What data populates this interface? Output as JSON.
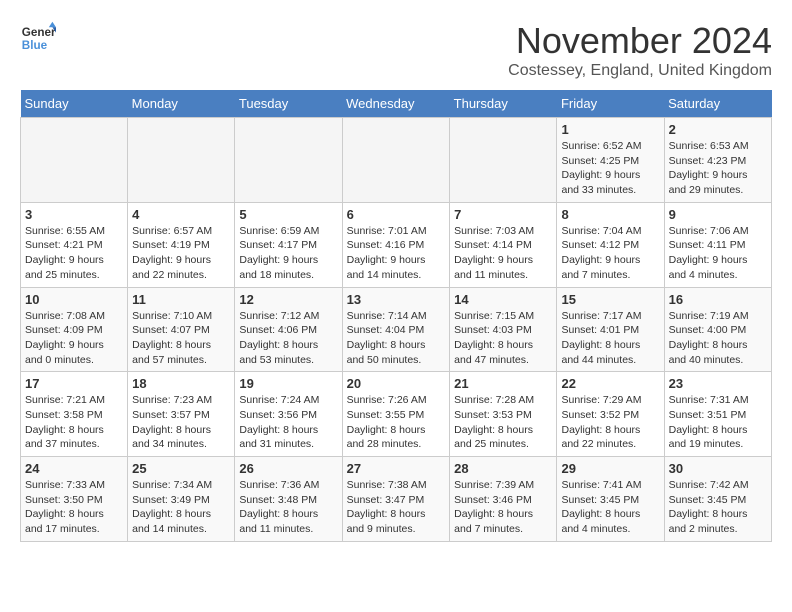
{
  "logo": {
    "line1": "General",
    "line2": "Blue"
  },
  "title": "November 2024",
  "location": "Costessey, England, United Kingdom",
  "days_of_week": [
    "Sunday",
    "Monday",
    "Tuesday",
    "Wednesday",
    "Thursday",
    "Friday",
    "Saturday"
  ],
  "weeks": [
    [
      {
        "day": "",
        "info": ""
      },
      {
        "day": "",
        "info": ""
      },
      {
        "day": "",
        "info": ""
      },
      {
        "day": "",
        "info": ""
      },
      {
        "day": "",
        "info": ""
      },
      {
        "day": "1",
        "info": "Sunrise: 6:52 AM\nSunset: 4:25 PM\nDaylight: 9 hours and 33 minutes."
      },
      {
        "day": "2",
        "info": "Sunrise: 6:53 AM\nSunset: 4:23 PM\nDaylight: 9 hours and 29 minutes."
      }
    ],
    [
      {
        "day": "3",
        "info": "Sunrise: 6:55 AM\nSunset: 4:21 PM\nDaylight: 9 hours and 25 minutes."
      },
      {
        "day": "4",
        "info": "Sunrise: 6:57 AM\nSunset: 4:19 PM\nDaylight: 9 hours and 22 minutes."
      },
      {
        "day": "5",
        "info": "Sunrise: 6:59 AM\nSunset: 4:17 PM\nDaylight: 9 hours and 18 minutes."
      },
      {
        "day": "6",
        "info": "Sunrise: 7:01 AM\nSunset: 4:16 PM\nDaylight: 9 hours and 14 minutes."
      },
      {
        "day": "7",
        "info": "Sunrise: 7:03 AM\nSunset: 4:14 PM\nDaylight: 9 hours and 11 minutes."
      },
      {
        "day": "8",
        "info": "Sunrise: 7:04 AM\nSunset: 4:12 PM\nDaylight: 9 hours and 7 minutes."
      },
      {
        "day": "9",
        "info": "Sunrise: 7:06 AM\nSunset: 4:11 PM\nDaylight: 9 hours and 4 minutes."
      }
    ],
    [
      {
        "day": "10",
        "info": "Sunrise: 7:08 AM\nSunset: 4:09 PM\nDaylight: 9 hours and 0 minutes."
      },
      {
        "day": "11",
        "info": "Sunrise: 7:10 AM\nSunset: 4:07 PM\nDaylight: 8 hours and 57 minutes."
      },
      {
        "day": "12",
        "info": "Sunrise: 7:12 AM\nSunset: 4:06 PM\nDaylight: 8 hours and 53 minutes."
      },
      {
        "day": "13",
        "info": "Sunrise: 7:14 AM\nSunset: 4:04 PM\nDaylight: 8 hours and 50 minutes."
      },
      {
        "day": "14",
        "info": "Sunrise: 7:15 AM\nSunset: 4:03 PM\nDaylight: 8 hours and 47 minutes."
      },
      {
        "day": "15",
        "info": "Sunrise: 7:17 AM\nSunset: 4:01 PM\nDaylight: 8 hours and 44 minutes."
      },
      {
        "day": "16",
        "info": "Sunrise: 7:19 AM\nSunset: 4:00 PM\nDaylight: 8 hours and 40 minutes."
      }
    ],
    [
      {
        "day": "17",
        "info": "Sunrise: 7:21 AM\nSunset: 3:58 PM\nDaylight: 8 hours and 37 minutes."
      },
      {
        "day": "18",
        "info": "Sunrise: 7:23 AM\nSunset: 3:57 PM\nDaylight: 8 hours and 34 minutes."
      },
      {
        "day": "19",
        "info": "Sunrise: 7:24 AM\nSunset: 3:56 PM\nDaylight: 8 hours and 31 minutes."
      },
      {
        "day": "20",
        "info": "Sunrise: 7:26 AM\nSunset: 3:55 PM\nDaylight: 8 hours and 28 minutes."
      },
      {
        "day": "21",
        "info": "Sunrise: 7:28 AM\nSunset: 3:53 PM\nDaylight: 8 hours and 25 minutes."
      },
      {
        "day": "22",
        "info": "Sunrise: 7:29 AM\nSunset: 3:52 PM\nDaylight: 8 hours and 22 minutes."
      },
      {
        "day": "23",
        "info": "Sunrise: 7:31 AM\nSunset: 3:51 PM\nDaylight: 8 hours and 19 minutes."
      }
    ],
    [
      {
        "day": "24",
        "info": "Sunrise: 7:33 AM\nSunset: 3:50 PM\nDaylight: 8 hours and 17 minutes."
      },
      {
        "day": "25",
        "info": "Sunrise: 7:34 AM\nSunset: 3:49 PM\nDaylight: 8 hours and 14 minutes."
      },
      {
        "day": "26",
        "info": "Sunrise: 7:36 AM\nSunset: 3:48 PM\nDaylight: 8 hours and 11 minutes."
      },
      {
        "day": "27",
        "info": "Sunrise: 7:38 AM\nSunset: 3:47 PM\nDaylight: 8 hours and 9 minutes."
      },
      {
        "day": "28",
        "info": "Sunrise: 7:39 AM\nSunset: 3:46 PM\nDaylight: 8 hours and 7 minutes."
      },
      {
        "day": "29",
        "info": "Sunrise: 7:41 AM\nSunset: 3:45 PM\nDaylight: 8 hours and 4 minutes."
      },
      {
        "day": "30",
        "info": "Sunrise: 7:42 AM\nSunset: 3:45 PM\nDaylight: 8 hours and 2 minutes."
      }
    ]
  ]
}
